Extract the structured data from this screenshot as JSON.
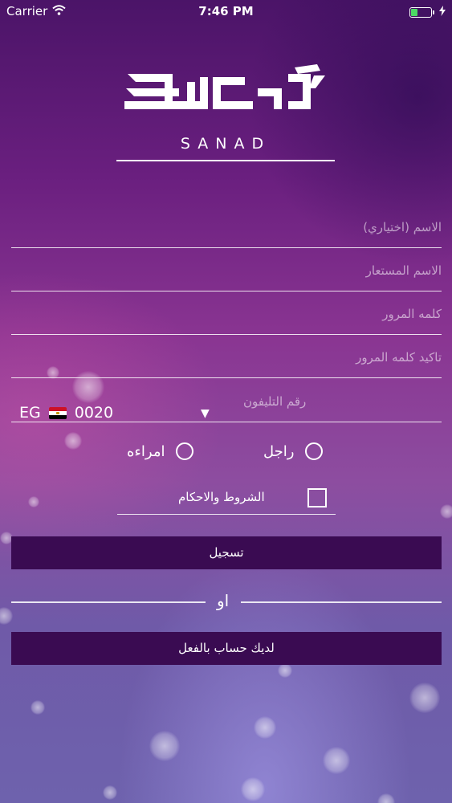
{
  "status_bar": {
    "carrier": "Carrier",
    "time": "7:46 PM",
    "battery_level": 0.35,
    "battery_color": "#4cd964"
  },
  "logo": {
    "wordmark": "SANAD"
  },
  "form": {
    "name_placeholder": "الاسم (اختياري)",
    "nickname_placeholder": "الاسم المستعار",
    "password_placeholder": "كلمه المرور",
    "confirm_password_placeholder": "تاكيد كلمه المرور",
    "phone_placeholder": "رقم التليفون",
    "country_code": "EG",
    "dial_code": "0020",
    "gender": {
      "male_label": "راجل",
      "female_label": "امراءه"
    },
    "terms_label": "الشروط والاحكام"
  },
  "buttons": {
    "register_label": "تسجيل",
    "or_label": "او",
    "have_account_label": "لديك حساب بالفعل",
    "button_color": "#3a0b52"
  },
  "icons": {
    "wifi": "wifi-icon",
    "charging": "charging-bolt-icon",
    "dropdown": "chevron-down-icon",
    "flag": "egypt-flag-icon"
  }
}
